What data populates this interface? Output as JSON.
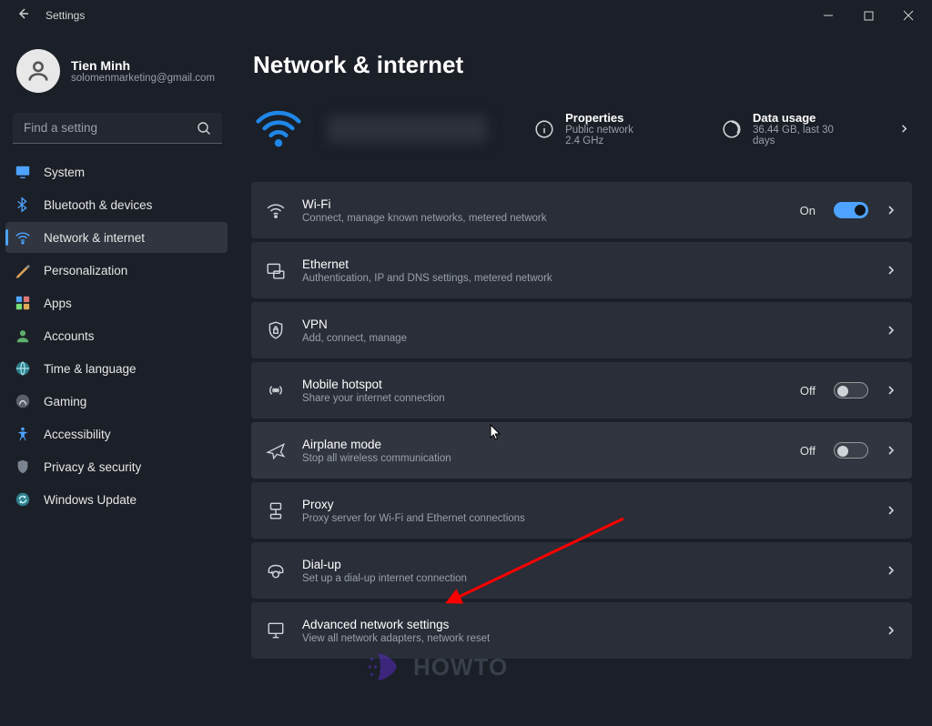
{
  "titlebar": {
    "title": "Settings"
  },
  "user": {
    "name": "Tien Minh",
    "email": "solomenmarketing@gmail.com"
  },
  "search": {
    "placeholder": "Find a setting"
  },
  "sidebar": [
    {
      "label": "System"
    },
    {
      "label": "Bluetooth & devices"
    },
    {
      "label": "Network & internet",
      "active": true
    },
    {
      "label": "Personalization"
    },
    {
      "label": "Apps"
    },
    {
      "label": "Accounts"
    },
    {
      "label": "Time & language"
    },
    {
      "label": "Gaming"
    },
    {
      "label": "Accessibility"
    },
    {
      "label": "Privacy & security"
    },
    {
      "label": "Windows Update"
    }
  ],
  "page": {
    "title": "Network & internet"
  },
  "hero": {
    "properties_label": "Properties",
    "properties_sub1": "Public network",
    "properties_sub2": "2.4 GHz",
    "usage_label": "Data usage",
    "usage_sub": "36.44 GB, last 30 days"
  },
  "rows": [
    {
      "title": "Wi-Fi",
      "sub": "Connect, manage known networks, metered network",
      "state": "On",
      "toggle": "on"
    },
    {
      "title": "Ethernet",
      "sub": "Authentication, IP and DNS settings, metered network"
    },
    {
      "title": "VPN",
      "sub": "Add, connect, manage"
    },
    {
      "title": "Mobile hotspot",
      "sub": "Share your internet connection",
      "state": "Off",
      "toggle": "off"
    },
    {
      "title": "Airplane mode",
      "sub": "Stop all wireless communication",
      "state": "Off",
      "toggle": "off",
      "hovered": true
    },
    {
      "title": "Proxy",
      "sub": "Proxy server for Wi-Fi and Ethernet connections"
    },
    {
      "title": "Dial-up",
      "sub": "Set up a dial-up internet connection"
    },
    {
      "title": "Advanced network settings",
      "sub": "View all network adapters, network reset"
    }
  ],
  "watermark": {
    "text": "HOWTO"
  }
}
